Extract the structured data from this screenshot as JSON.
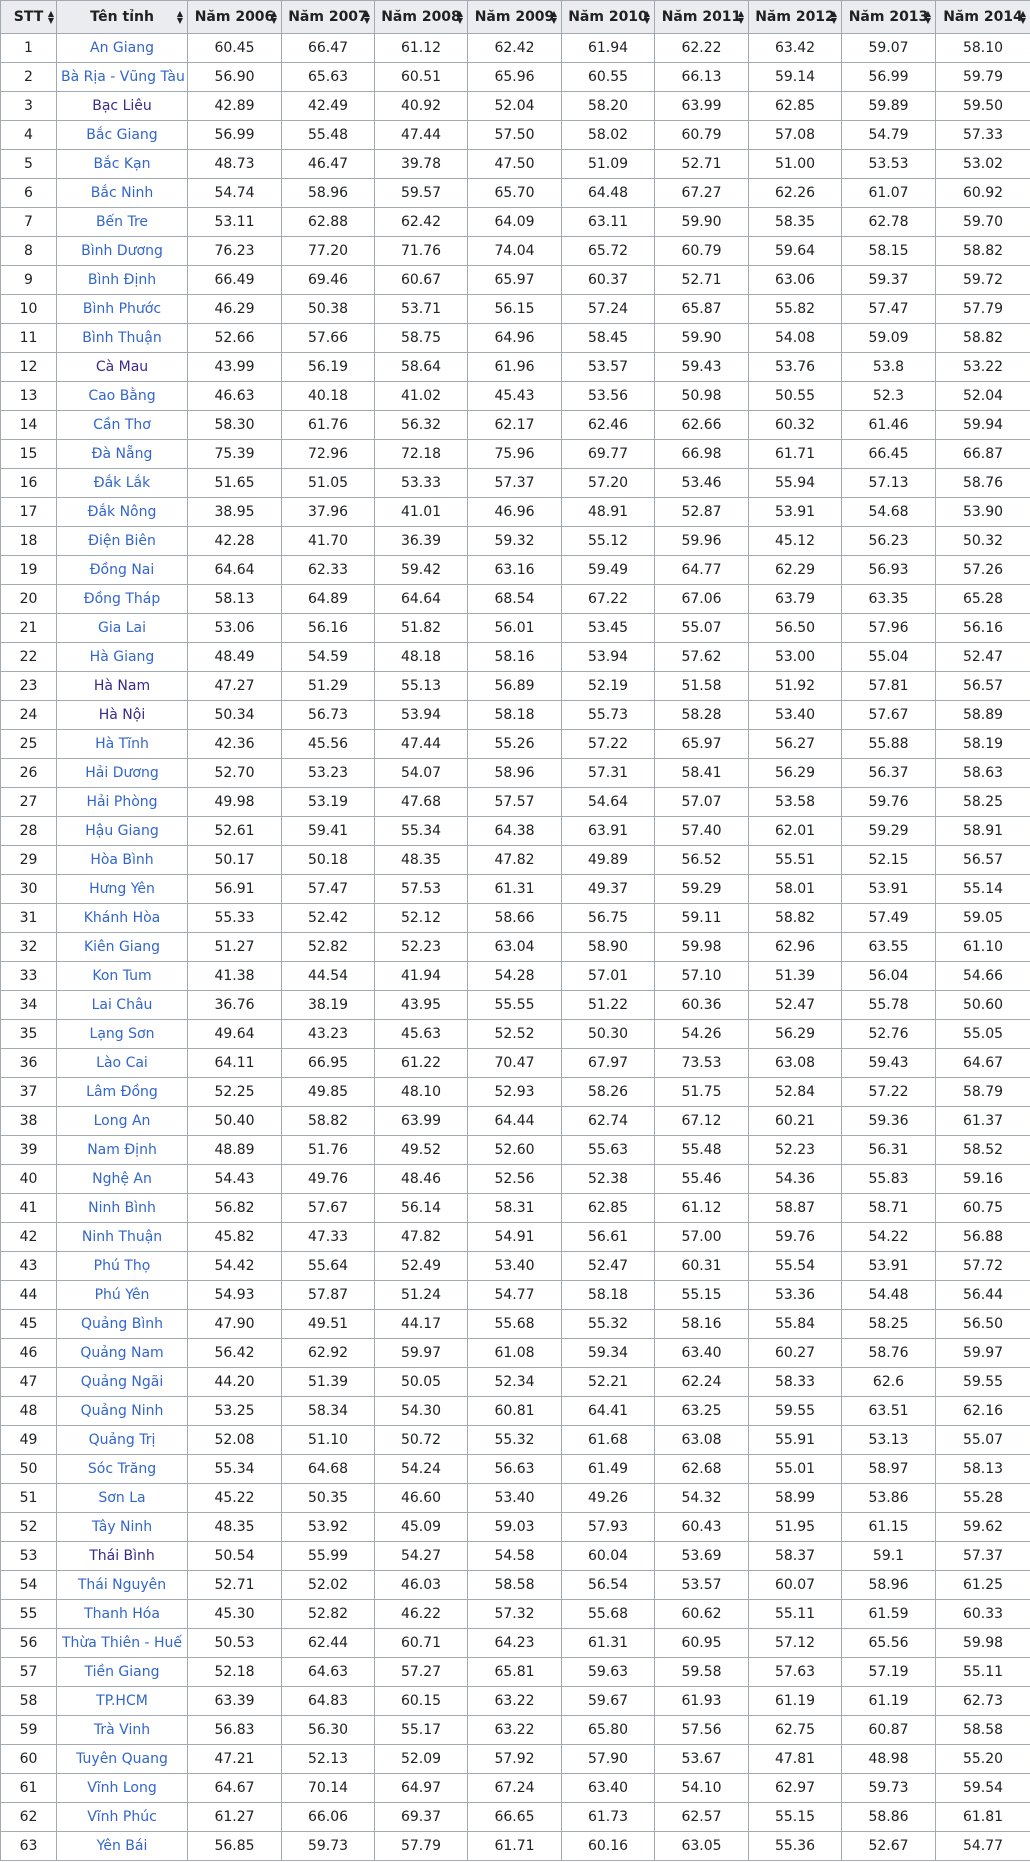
{
  "headers": [
    "STT",
    "Tên tỉnh",
    "Năm 2006",
    "Năm 2007",
    "Năm 2008",
    "Năm 2009",
    "Năm 2010",
    "Năm 2011",
    "Năm 2012",
    "Năm 2013",
    "Năm 2014"
  ],
  "sort_icon": "sort-updown-icon",
  "colors": {
    "header_bg": "#eaecf0",
    "border": "#a2a9b1",
    "link": "#3366cc",
    "link_visited": "#3a2a8a"
  },
  "rows": [
    {
      "stt": "1",
      "name": "An Giang",
      "visited": false,
      "v": [
        "60.45",
        "66.47",
        "61.12",
        "62.42",
        "61.94",
        "62.22",
        "63.42",
        "59.07",
        "58.10"
      ]
    },
    {
      "stt": "2",
      "name": "Bà Rịa - Vũng Tàu",
      "visited": false,
      "v": [
        "56.90",
        "65.63",
        "60.51",
        "65.96",
        "60.55",
        "66.13",
        "59.14",
        "56.99",
        "59.79"
      ]
    },
    {
      "stt": "3",
      "name": "Bạc Liêu",
      "visited": true,
      "v": [
        "42.89",
        "42.49",
        "40.92",
        "52.04",
        "58.20",
        "63.99",
        "62.85",
        "59.89",
        "59.50"
      ]
    },
    {
      "stt": "4",
      "name": "Bắc Giang",
      "visited": false,
      "v": [
        "56.99",
        "55.48",
        "47.44",
        "57.50",
        "58.02",
        "60.79",
        "57.08",
        "54.79",
        "57.33"
      ]
    },
    {
      "stt": "5",
      "name": "Bắc Kạn",
      "visited": false,
      "v": [
        "48.73",
        "46.47",
        "39.78",
        "47.50",
        "51.09",
        "52.71",
        "51.00",
        "53.53",
        "53.02"
      ]
    },
    {
      "stt": "6",
      "name": "Bắc Ninh",
      "visited": false,
      "v": [
        "54.74",
        "58.96",
        "59.57",
        "65.70",
        "64.48",
        "67.27",
        "62.26",
        "61.07",
        "60.92"
      ]
    },
    {
      "stt": "7",
      "name": "Bến Tre",
      "visited": false,
      "v": [
        "53.11",
        "62.88",
        "62.42",
        "64.09",
        "63.11",
        "59.90",
        "58.35",
        "62.78",
        "59.70"
      ]
    },
    {
      "stt": "8",
      "name": "Bình Dương",
      "visited": false,
      "v": [
        "76.23",
        "77.20",
        "71.76",
        "74.04",
        "65.72",
        "60.79",
        "59.64",
        "58.15",
        "58.82"
      ]
    },
    {
      "stt": "9",
      "name": "Bình Định",
      "visited": false,
      "v": [
        "66.49",
        "69.46",
        "60.67",
        "65.97",
        "60.37",
        "52.71",
        "63.06",
        "59.37",
        "59.72"
      ]
    },
    {
      "stt": "10",
      "name": "Bình Phước",
      "visited": false,
      "v": [
        "46.29",
        "50.38",
        "53.71",
        "56.15",
        "57.24",
        "65.87",
        "55.82",
        "57.47",
        "57.79"
      ]
    },
    {
      "stt": "11",
      "name": "Bình Thuận",
      "visited": false,
      "v": [
        "52.66",
        "57.66",
        "58.75",
        "64.96",
        "58.45",
        "59.90",
        "54.08",
        "59.09",
        "58.82"
      ]
    },
    {
      "stt": "12",
      "name": "Cà Mau",
      "visited": true,
      "v": [
        "43.99",
        "56.19",
        "58.64",
        "61.96",
        "53.57",
        "59.43",
        "53.76",
        "53.8",
        "53.22"
      ]
    },
    {
      "stt": "13",
      "name": "Cao Bằng",
      "visited": false,
      "v": [
        "46.63",
        "40.18",
        "41.02",
        "45.43",
        "53.56",
        "50.98",
        "50.55",
        "52.3",
        "52.04"
      ]
    },
    {
      "stt": "14",
      "name": "Cần Thơ",
      "visited": false,
      "v": [
        "58.30",
        "61.76",
        "56.32",
        "62.17",
        "62.46",
        "62.66",
        "60.32",
        "61.46",
        "59.94"
      ]
    },
    {
      "stt": "15",
      "name": "Đà Nẵng",
      "visited": false,
      "v": [
        "75.39",
        "72.96",
        "72.18",
        "75.96",
        "69.77",
        "66.98",
        "61.71",
        "66.45",
        "66.87"
      ]
    },
    {
      "stt": "16",
      "name": "Đắk Lắk",
      "visited": false,
      "v": [
        "51.65",
        "51.05",
        "53.33",
        "57.37",
        "57.20",
        "53.46",
        "55.94",
        "57.13",
        "58.76"
      ]
    },
    {
      "stt": "17",
      "name": "Đắk Nông",
      "visited": false,
      "v": [
        "38.95",
        "37.96",
        "41.01",
        "46.96",
        "48.91",
        "52.87",
        "53.91",
        "54.68",
        "53.90"
      ]
    },
    {
      "stt": "18",
      "name": "Điện Biên",
      "visited": false,
      "v": [
        "42.28",
        "41.70",
        "36.39",
        "59.32",
        "55.12",
        "59.96",
        "45.12",
        "56.23",
        "50.32"
      ]
    },
    {
      "stt": "19",
      "name": "Đồng Nai",
      "visited": false,
      "v": [
        "64.64",
        "62.33",
        "59.42",
        "63.16",
        "59.49",
        "64.77",
        "62.29",
        "56.93",
        "57.26"
      ]
    },
    {
      "stt": "20",
      "name": "Đồng Tháp",
      "visited": false,
      "v": [
        "58.13",
        "64.89",
        "64.64",
        "68.54",
        "67.22",
        "67.06",
        "63.79",
        "63.35",
        "65.28"
      ]
    },
    {
      "stt": "21",
      "name": "Gia Lai",
      "visited": false,
      "v": [
        "53.06",
        "56.16",
        "51.82",
        "56.01",
        "53.45",
        "55.07",
        "56.50",
        "57.96",
        "56.16"
      ]
    },
    {
      "stt": "22",
      "name": "Hà Giang",
      "visited": false,
      "v": [
        "48.49",
        "54.59",
        "48.18",
        "58.16",
        "53.94",
        "57.62",
        "53.00",
        "55.04",
        "52.47"
      ]
    },
    {
      "stt": "23",
      "name": "Hà Nam",
      "visited": true,
      "v": [
        "47.27",
        "51.29",
        "55.13",
        "56.89",
        "52.19",
        "51.58",
        "51.92",
        "57.81",
        "56.57"
      ]
    },
    {
      "stt": "24",
      "name": "Hà Nội",
      "visited": true,
      "v": [
        "50.34",
        "56.73",
        "53.94",
        "58.18",
        "55.73",
        "58.28",
        "53.40",
        "57.67",
        "58.89"
      ]
    },
    {
      "stt": "25",
      "name": "Hà Tĩnh",
      "visited": false,
      "v": [
        "42.36",
        "45.56",
        "47.44",
        "55.26",
        "57.22",
        "65.97",
        "56.27",
        "55.88",
        "58.19"
      ]
    },
    {
      "stt": "26",
      "name": "Hải Dương",
      "visited": false,
      "v": [
        "52.70",
        "53.23",
        "54.07",
        "58.96",
        "57.31",
        "58.41",
        "56.29",
        "56.37",
        "58.63"
      ]
    },
    {
      "stt": "27",
      "name": "Hải Phòng",
      "visited": false,
      "v": [
        "49.98",
        "53.19",
        "47.68",
        "57.57",
        "54.64",
        "57.07",
        "53.58",
        "59.76",
        "58.25"
      ]
    },
    {
      "stt": "28",
      "name": "Hậu Giang",
      "visited": false,
      "v": [
        "52.61",
        "59.41",
        "55.34",
        "64.38",
        "63.91",
        "57.40",
        "62.01",
        "59.29",
        "58.91"
      ]
    },
    {
      "stt": "29",
      "name": "Hòa Bình",
      "visited": false,
      "v": [
        "50.17",
        "50.18",
        "48.35",
        "47.82",
        "49.89",
        "56.52",
        "55.51",
        "52.15",
        "56.57"
      ]
    },
    {
      "stt": "30",
      "name": "Hưng Yên",
      "visited": false,
      "v": [
        "56.91",
        "57.47",
        "57.53",
        "61.31",
        "49.37",
        "59.29",
        "58.01",
        "53.91",
        "55.14"
      ]
    },
    {
      "stt": "31",
      "name": "Khánh Hòa",
      "visited": false,
      "v": [
        "55.33",
        "52.42",
        "52.12",
        "58.66",
        "56.75",
        "59.11",
        "58.82",
        "57.49",
        "59.05"
      ]
    },
    {
      "stt": "32",
      "name": "Kiên Giang",
      "visited": false,
      "v": [
        "51.27",
        "52.82",
        "52.23",
        "63.04",
        "58.90",
        "59.98",
        "62.96",
        "63.55",
        "61.10"
      ]
    },
    {
      "stt": "33",
      "name": "Kon Tum",
      "visited": false,
      "v": [
        "41.38",
        "44.54",
        "41.94",
        "54.28",
        "57.01",
        "57.10",
        "51.39",
        "56.04",
        "54.66"
      ]
    },
    {
      "stt": "34",
      "name": "Lai Châu",
      "visited": false,
      "v": [
        "36.76",
        "38.19",
        "43.95",
        "55.55",
        "51.22",
        "60.36",
        "52.47",
        "55.78",
        "50.60"
      ]
    },
    {
      "stt": "35",
      "name": "Lạng Sơn",
      "visited": false,
      "v": [
        "49.64",
        "43.23",
        "45.63",
        "52.52",
        "50.30",
        "54.26",
        "56.29",
        "52.76",
        "55.05"
      ]
    },
    {
      "stt": "36",
      "name": "Lào Cai",
      "visited": false,
      "v": [
        "64.11",
        "66.95",
        "61.22",
        "70.47",
        "67.97",
        "73.53",
        "63.08",
        "59.43",
        "64.67"
      ]
    },
    {
      "stt": "37",
      "name": "Lâm Đồng",
      "visited": false,
      "v": [
        "52.25",
        "49.85",
        "48.10",
        "52.93",
        "58.26",
        "51.75",
        "52.84",
        "57.22",
        "58.79"
      ]
    },
    {
      "stt": "38",
      "name": "Long An",
      "visited": false,
      "v": [
        "50.40",
        "58.82",
        "63.99",
        "64.44",
        "62.74",
        "67.12",
        "60.21",
        "59.36",
        "61.37"
      ]
    },
    {
      "stt": "39",
      "name": "Nam Định",
      "visited": false,
      "v": [
        "48.89",
        "51.76",
        "49.52",
        "52.60",
        "55.63",
        "55.48",
        "52.23",
        "56.31",
        "58.52"
      ]
    },
    {
      "stt": "40",
      "name": "Nghệ An",
      "visited": false,
      "v": [
        "54.43",
        "49.76",
        "48.46",
        "52.56",
        "52.38",
        "55.46",
        "54.36",
        "55.83",
        "59.16"
      ]
    },
    {
      "stt": "41",
      "name": "Ninh Bình",
      "visited": false,
      "v": [
        "56.82",
        "57.67",
        "56.14",
        "58.31",
        "62.85",
        "61.12",
        "58.87",
        "58.71",
        "60.75"
      ]
    },
    {
      "stt": "42",
      "name": "Ninh Thuận",
      "visited": false,
      "v": [
        "45.82",
        "47.33",
        "47.82",
        "54.91",
        "56.61",
        "57.00",
        "59.76",
        "54.22",
        "56.88"
      ]
    },
    {
      "stt": "43",
      "name": "Phú Thọ",
      "visited": false,
      "v": [
        "54.42",
        "55.64",
        "52.49",
        "53.40",
        "52.47",
        "60.31",
        "55.54",
        "53.91",
        "57.72"
      ]
    },
    {
      "stt": "44",
      "name": "Phú Yên",
      "visited": false,
      "v": [
        "54.93",
        "57.87",
        "51.24",
        "54.77",
        "58.18",
        "55.15",
        "53.36",
        "54.48",
        "56.44"
      ]
    },
    {
      "stt": "45",
      "name": "Quảng Bình",
      "visited": false,
      "v": [
        "47.90",
        "49.51",
        "44.17",
        "55.68",
        "55.32",
        "58.16",
        "55.84",
        "58.25",
        "56.50"
      ]
    },
    {
      "stt": "46",
      "name": "Quảng Nam",
      "visited": false,
      "v": [
        "56.42",
        "62.92",
        "59.97",
        "61.08",
        "59.34",
        "63.40",
        "60.27",
        "58.76",
        "59.97"
      ]
    },
    {
      "stt": "47",
      "name": "Quảng Ngãi",
      "visited": false,
      "v": [
        "44.20",
        "51.39",
        "50.05",
        "52.34",
        "52.21",
        "62.24",
        "58.33",
        "62.6",
        "59.55"
      ]
    },
    {
      "stt": "48",
      "name": "Quảng Ninh",
      "visited": false,
      "v": [
        "53.25",
        "58.34",
        "54.30",
        "60.81",
        "64.41",
        "63.25",
        "59.55",
        "63.51",
        "62.16"
      ]
    },
    {
      "stt": "49",
      "name": "Quảng Trị",
      "visited": false,
      "v": [
        "52.08",
        "51.10",
        "50.72",
        "55.32",
        "61.68",
        "63.08",
        "55.91",
        "53.13",
        "55.07"
      ]
    },
    {
      "stt": "50",
      "name": "Sóc Trăng",
      "visited": false,
      "v": [
        "55.34",
        "64.68",
        "54.24",
        "56.63",
        "61.49",
        "62.68",
        "55.01",
        "58.97",
        "58.13"
      ]
    },
    {
      "stt": "51",
      "name": "Sơn La",
      "visited": false,
      "v": [
        "45.22",
        "50.35",
        "46.60",
        "53.40",
        "49.26",
        "54.32",
        "58.99",
        "53.86",
        "55.28"
      ]
    },
    {
      "stt": "52",
      "name": "Tây Ninh",
      "visited": false,
      "v": [
        "48.35",
        "53.92",
        "45.09",
        "59.03",
        "57.93",
        "60.43",
        "51.95",
        "61.15",
        "59.62"
      ]
    },
    {
      "stt": "53",
      "name": "Thái Bình",
      "visited": true,
      "v": [
        "50.54",
        "55.99",
        "54.27",
        "54.58",
        "60.04",
        "53.69",
        "58.37",
        "59.1",
        "57.37"
      ]
    },
    {
      "stt": "54",
      "name": "Thái Nguyên",
      "visited": false,
      "v": [
        "52.71",
        "52.02",
        "46.03",
        "58.58",
        "56.54",
        "53.57",
        "60.07",
        "58.96",
        "61.25"
      ]
    },
    {
      "stt": "55",
      "name": "Thanh Hóa",
      "visited": false,
      "v": [
        "45.30",
        "52.82",
        "46.22",
        "57.32",
        "55.68",
        "60.62",
        "55.11",
        "61.59",
        "60.33"
      ]
    },
    {
      "stt": "56",
      "name": "Thừa Thiên - Huế",
      "visited": false,
      "v": [
        "50.53",
        "62.44",
        "60.71",
        "64.23",
        "61.31",
        "60.95",
        "57.12",
        "65.56",
        "59.98"
      ]
    },
    {
      "stt": "57",
      "name": "Tiền Giang",
      "visited": false,
      "v": [
        "52.18",
        "64.63",
        "57.27",
        "65.81",
        "59.63",
        "59.58",
        "57.63",
        "57.19",
        "55.11"
      ]
    },
    {
      "stt": "58",
      "name": "TP.HCM",
      "visited": false,
      "v": [
        "63.39",
        "64.83",
        "60.15",
        "63.22",
        "59.67",
        "61.93",
        "61.19",
        "61.19",
        "62.73"
      ]
    },
    {
      "stt": "59",
      "name": "Trà Vinh",
      "visited": false,
      "v": [
        "56.83",
        "56.30",
        "55.17",
        "63.22",
        "65.80",
        "57.56",
        "62.75",
        "60.87",
        "58.58"
      ]
    },
    {
      "stt": "60",
      "name": "Tuyên Quang",
      "visited": false,
      "v": [
        "47.21",
        "52.13",
        "52.09",
        "57.92",
        "57.90",
        "53.67",
        "47.81",
        "48.98",
        "55.20"
      ]
    },
    {
      "stt": "61",
      "name": "Vĩnh Long",
      "visited": false,
      "v": [
        "64.67",
        "70.14",
        "64.97",
        "67.24",
        "63.40",
        "54.10",
        "62.97",
        "59.73",
        "59.54"
      ]
    },
    {
      "stt": "62",
      "name": "Vĩnh Phúc",
      "visited": false,
      "v": [
        "61.27",
        "66.06",
        "69.37",
        "66.65",
        "61.73",
        "62.57",
        "55.15",
        "58.86",
        "61.81"
      ]
    },
    {
      "stt": "63",
      "name": "Yên Bái",
      "visited": false,
      "v": [
        "56.85",
        "59.73",
        "57.79",
        "61.71",
        "60.16",
        "63.05",
        "55.36",
        "52.67",
        "54.77"
      ]
    }
  ]
}
